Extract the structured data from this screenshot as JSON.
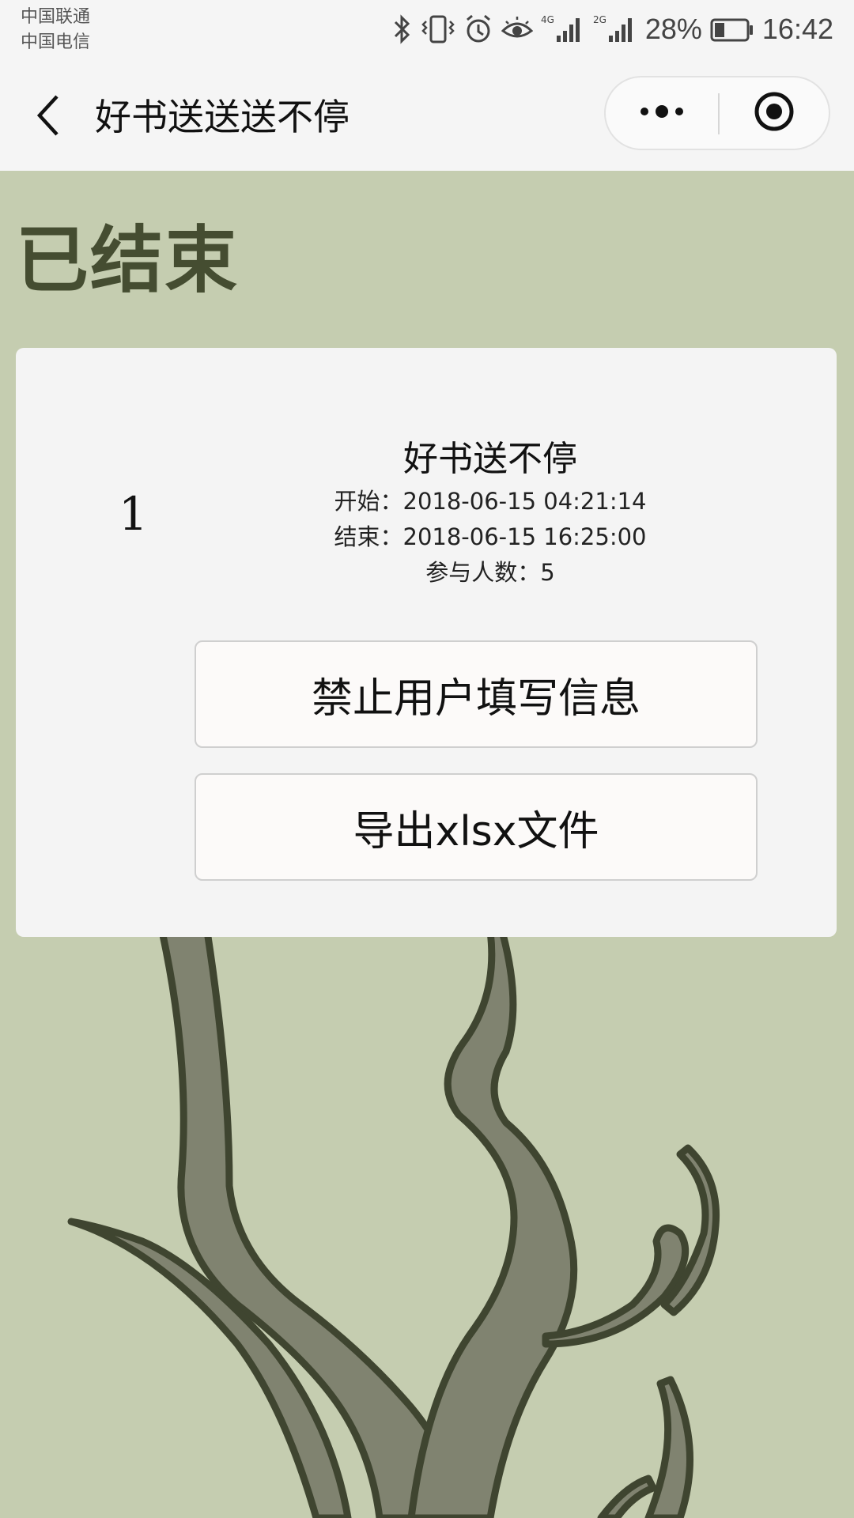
{
  "status_bar": {
    "carriers": [
      "中国联通",
      "中国电信"
    ],
    "battery": "28%",
    "time": "16:42",
    "network_1": "4G",
    "network_2": "2G",
    "icons": [
      "bluetooth-icon",
      "vibrate-icon",
      "alarm-icon",
      "eye-icon",
      "signal-icon",
      "battery-icon"
    ]
  },
  "nav": {
    "title": "好书送送送不停",
    "back_icon": "chevron-left-icon",
    "more_icon": "more-dots-icon",
    "close_icon": "target-close-icon"
  },
  "page": {
    "heading": "已结束",
    "background_color": "#c5cdb0",
    "accent_color": "#454d31"
  },
  "activity": {
    "index": "1",
    "title": "好书送不停",
    "start": "开始：2018-06-15 04:21:14",
    "end": "结束：2018-06-15 16:25:00",
    "participants": "参与人数：5",
    "disable_button": "禁止用户填写信息",
    "export_button": "导出xlsx文件"
  }
}
